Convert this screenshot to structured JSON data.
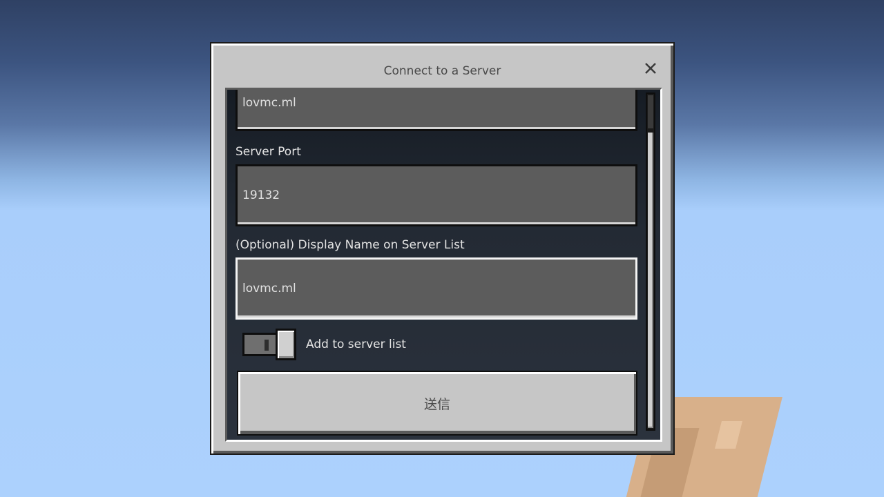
{
  "dialog": {
    "title": "Connect to a Server"
  },
  "form": {
    "server_address_value": "lovmc.ml",
    "server_port_label": "Server Port",
    "server_port_value": "19132",
    "display_name_label": "(Optional) Display Name on Server List",
    "display_name_value": "lovmc.ml",
    "add_to_list_label": "Add to server list",
    "add_to_list_checked": true,
    "submit_label": "送信"
  },
  "icons": {
    "close": "close-icon"
  }
}
